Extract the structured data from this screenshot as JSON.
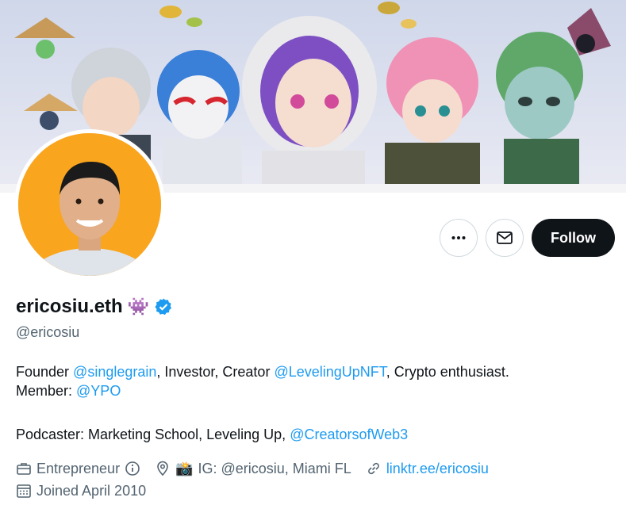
{
  "profile": {
    "display_name": "ericosiu.eth",
    "name_emoji": "👾",
    "handle": "@ericosiu",
    "verified_badge": "verified-icon"
  },
  "actions": {
    "more_icon": "more-icon",
    "message_icon": "mail-icon",
    "follow_label": "Follow"
  },
  "bio": {
    "line1_a": "Founder ",
    "line1_mention1": "@singlegrain",
    "line1_b": ", Investor, Creator ",
    "line1_mention2": "@LevelingUpNFT",
    "line1_c": ", Crypto enthusiast.",
    "line2_a": "Member: ",
    "line2_mention": "@YPO",
    "line3_a": "Podcaster: Marketing School, Leveling Up, ",
    "line3_mention": "@CreatorsofWeb3"
  },
  "meta": {
    "category": "Entrepreneur",
    "location": "IG: @ericosiu, Miami FL",
    "location_emoji": "📸",
    "website": "linktr.ee/ericosiu",
    "joined": "Joined April 2010"
  },
  "colors": {
    "accent": "#1d9bf0",
    "secondary_text": "#536471",
    "follow_bg": "#0f1419",
    "avatar_bg": "#f9a51e"
  }
}
